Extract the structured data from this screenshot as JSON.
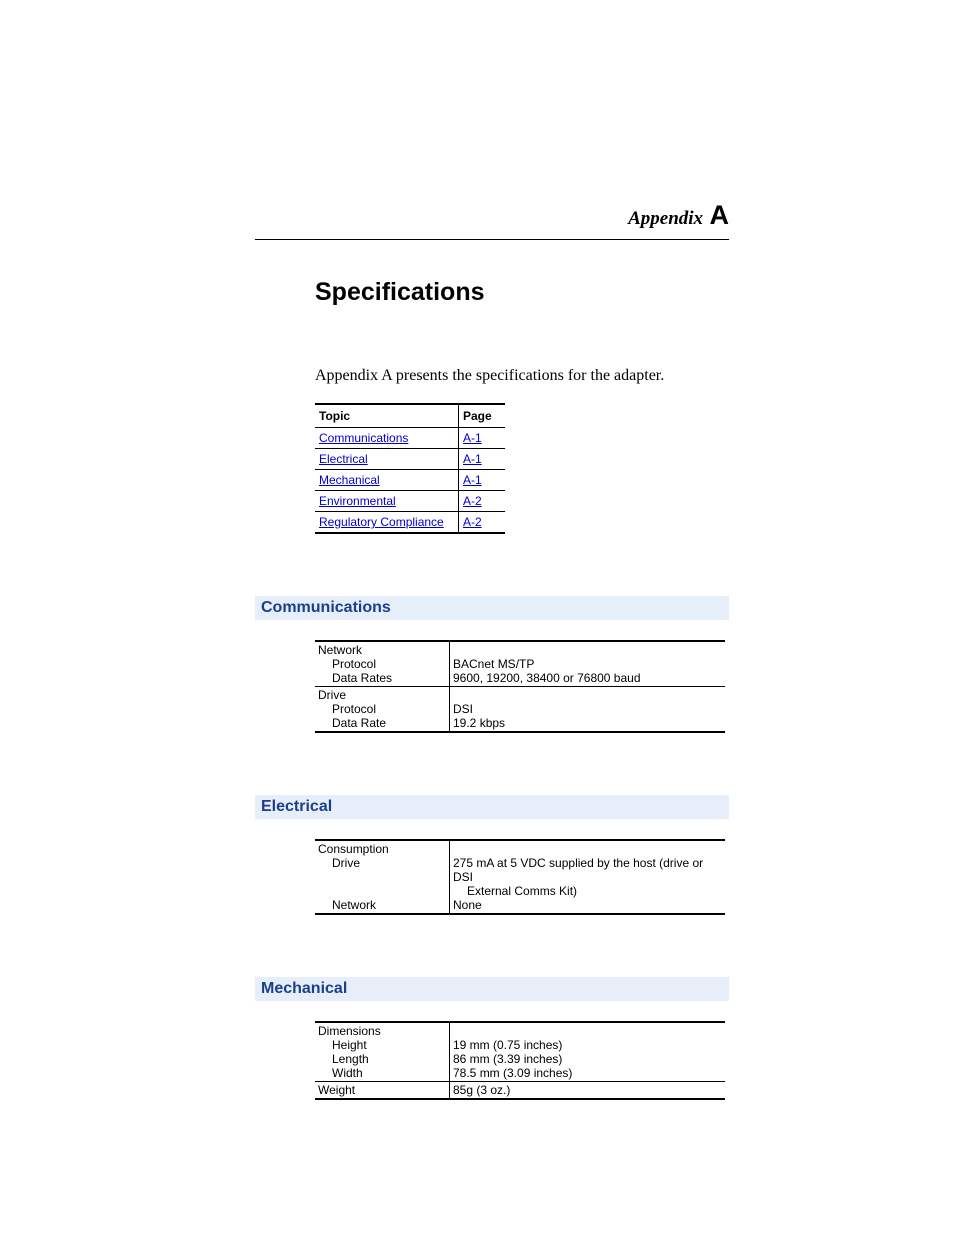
{
  "header": {
    "appendix_label": "Appendix",
    "appendix_letter": "A"
  },
  "title": "Specifications",
  "intro": "Appendix A presents the specifications for the adapter.",
  "toc": {
    "head_topic": "Topic",
    "head_page": "Page",
    "rows": [
      {
        "topic": "Communications",
        "page": "A-1"
      },
      {
        "topic": "Electrical",
        "page": "A-1"
      },
      {
        "topic": "Mechanical",
        "page": "A-1"
      },
      {
        "topic": "Environmental",
        "page": "A-2"
      },
      {
        "topic": "Regulatory Compliance",
        "page": "A-2"
      }
    ]
  },
  "sections": {
    "communications": {
      "heading": "Communications",
      "groups": [
        {
          "label": "Network",
          "rows": [
            {
              "k": "Protocol",
              "v": "BACnet MS/TP"
            },
            {
              "k": "Data Rates",
              "v": "9600, 19200, 38400 or 76800 baud"
            }
          ]
        },
        {
          "label": "Drive",
          "rows": [
            {
              "k": "Protocol",
              "v": "DSI"
            },
            {
              "k": "Data Rate",
              "v": "19.2 kbps"
            }
          ]
        }
      ]
    },
    "electrical": {
      "heading": "Electrical",
      "group_label": "Consumption",
      "drive_label": "Drive",
      "drive_value_l1": "275 mA at 5 VDC supplied by the host (drive or DSI",
      "drive_value_l2": "External Comms Kit)",
      "network_label": "Network",
      "network_value": "None"
    },
    "mechanical": {
      "heading": "Mechanical",
      "dim_label": "Dimensions",
      "rows": [
        {
          "k": "Height",
          "v": "19 mm (0.75 inches)"
        },
        {
          "k": "Length",
          "v": "86 mm (3.39 inches)"
        },
        {
          "k": "Width",
          "v": "78.5 mm (3.09 inches)"
        }
      ],
      "weight_label": "Weight",
      "weight_value": "85g (3 oz.)"
    }
  }
}
